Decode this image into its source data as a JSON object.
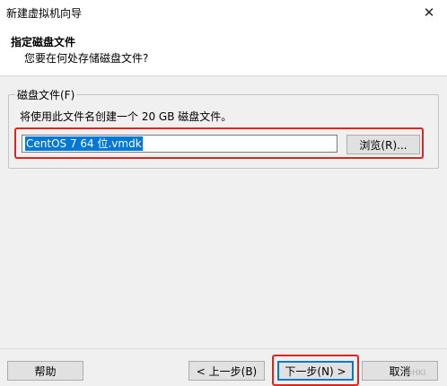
{
  "window": {
    "title": "新建虚拟机向导",
    "close_glyph": "✕"
  },
  "header": {
    "title": "指定磁盘文件",
    "subtitle": "您要在何处存储磁盘文件?"
  },
  "disk_file": {
    "group_label": "磁盘文件(F)",
    "description": "将使用此文件名创建一个 20 GB 磁盘文件。",
    "filename": "CentOS 7 64 位.vmdk",
    "browse_label": "浏览(R)..."
  },
  "footer": {
    "help_label": "帮助",
    "back_label": "< 上一步(B)",
    "next_label": "下一步(N) >",
    "cancel_label": "取消"
  },
  "watermark": "@HKI",
  "colors": {
    "selection": "#0078d7",
    "highlight_box": "#e0251e"
  }
}
